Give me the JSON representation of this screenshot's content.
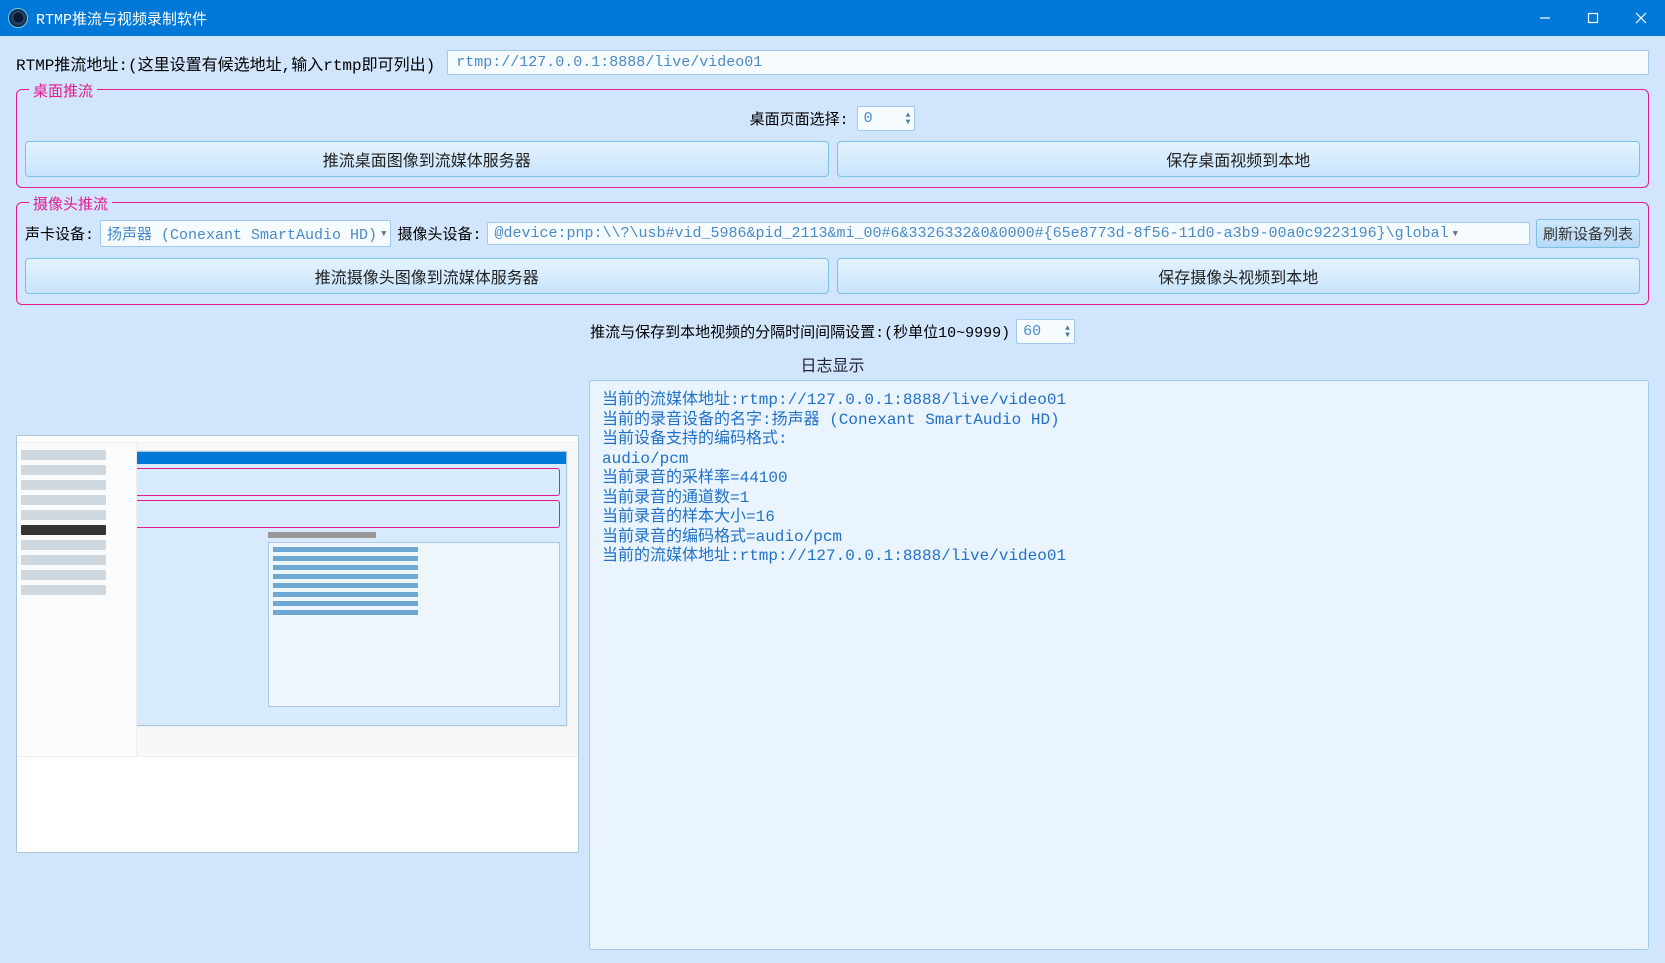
{
  "window": {
    "title": "RTMP推流与视频录制软件"
  },
  "rtmp": {
    "label": "RTMP推流地址:(这里设置有候选地址,输入rtmp即可列出)",
    "value": "rtmp://127.0.0.1:8888/live/video01"
  },
  "desktop": {
    "legend": "桌面推流",
    "page_label": "桌面页面选择:",
    "page_value": "0",
    "push_btn": "推流桌面图像到流媒体服务器",
    "save_btn": "保存桌面视频到本地"
  },
  "camera": {
    "legend": "摄像头推流",
    "audio_label": "声卡设备:",
    "audio_device": "扬声器 (Conexant SmartAudio HD)",
    "cam_label": "摄像头设备:",
    "cam_device": "@device:pnp:\\\\?\\usb#vid_5986&pid_2113&mi_00#6&3326332&0&0000#{65e8773d-8f56-11d0-a3b9-00a0c9223196}\\global",
    "refresh_btn": "刷新设备列表",
    "push_btn": "推流摄像头图像到流媒体服务器",
    "save_btn": "保存摄像头视频到本地"
  },
  "interval": {
    "label": "推流与保存到本地视频的分隔时间间隔设置:(秒单位10~9999)",
    "value": "60"
  },
  "log": {
    "header": "日志显示",
    "lines": [
      "当前的流媒体地址:rtmp://127.0.0.1:8888/live/video01",
      "当前的录音设备的名字:扬声器 (Conexant SmartAudio HD)",
      "当前设备支持的编码格式:",
      "audio/pcm",
      "当前录音的采样率=44100",
      "当前录音的通道数=1",
      "当前录音的样本大小=16",
      "当前录音的编码格式=audio/pcm",
      "当前的流媒体地址:rtmp://127.0.0.1:8888/live/video01"
    ]
  }
}
